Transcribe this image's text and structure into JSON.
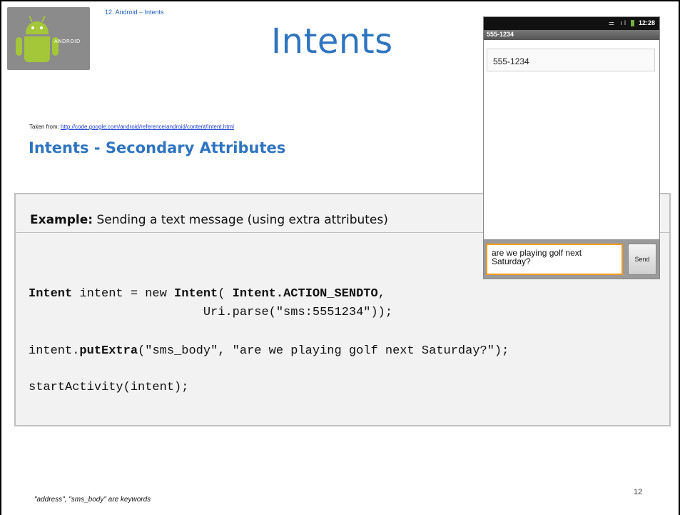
{
  "header": {
    "breadcrumb": "12. Android – Intents",
    "title": "Intents",
    "logo_text": "ANDROID"
  },
  "source": {
    "prefix": "Taken from:",
    "link": "http://code.google.com/android/reference/android/content/Intent.html"
  },
  "section": {
    "heading": "Intents - Secondary Attributes"
  },
  "example": {
    "label_bold": "Example:",
    "label_rest": " Sending a text message (using extra attributes)"
  },
  "code": {
    "line1_a": "Intent",
    "line1_b": " intent = new ",
    "line1_c": "Intent",
    "line1_d": "( ",
    "line1_e": "Intent.ACTION_SENDTO",
    "line1_f": ",",
    "line2": "                        Uri.parse(\"sms:5551234\"));",
    "line3_a": "intent.",
    "line3_b": "putExtra",
    "line3_c": "(\"sms_body\", \"are we playing golf next Saturday?\");",
    "line4": "startActivity(intent);"
  },
  "phone": {
    "status_time": "12:28",
    "status_icons": "⚌ ıl",
    "window_title": "555-1234",
    "to_value": "555-1234",
    "message_value": "are we playing golf next Saturday?",
    "send_label": "Send",
    "colors": {
      "accent": "#f29a1e",
      "battery": "#6fb13c"
    }
  },
  "footer": {
    "note": "\"address\", \"sms_body\"  are keywords",
    "page_number": "12"
  },
  "colors": {
    "title": "#2e74c0",
    "link": "#1e3fd6",
    "box_bg": "#f2f2f2"
  }
}
